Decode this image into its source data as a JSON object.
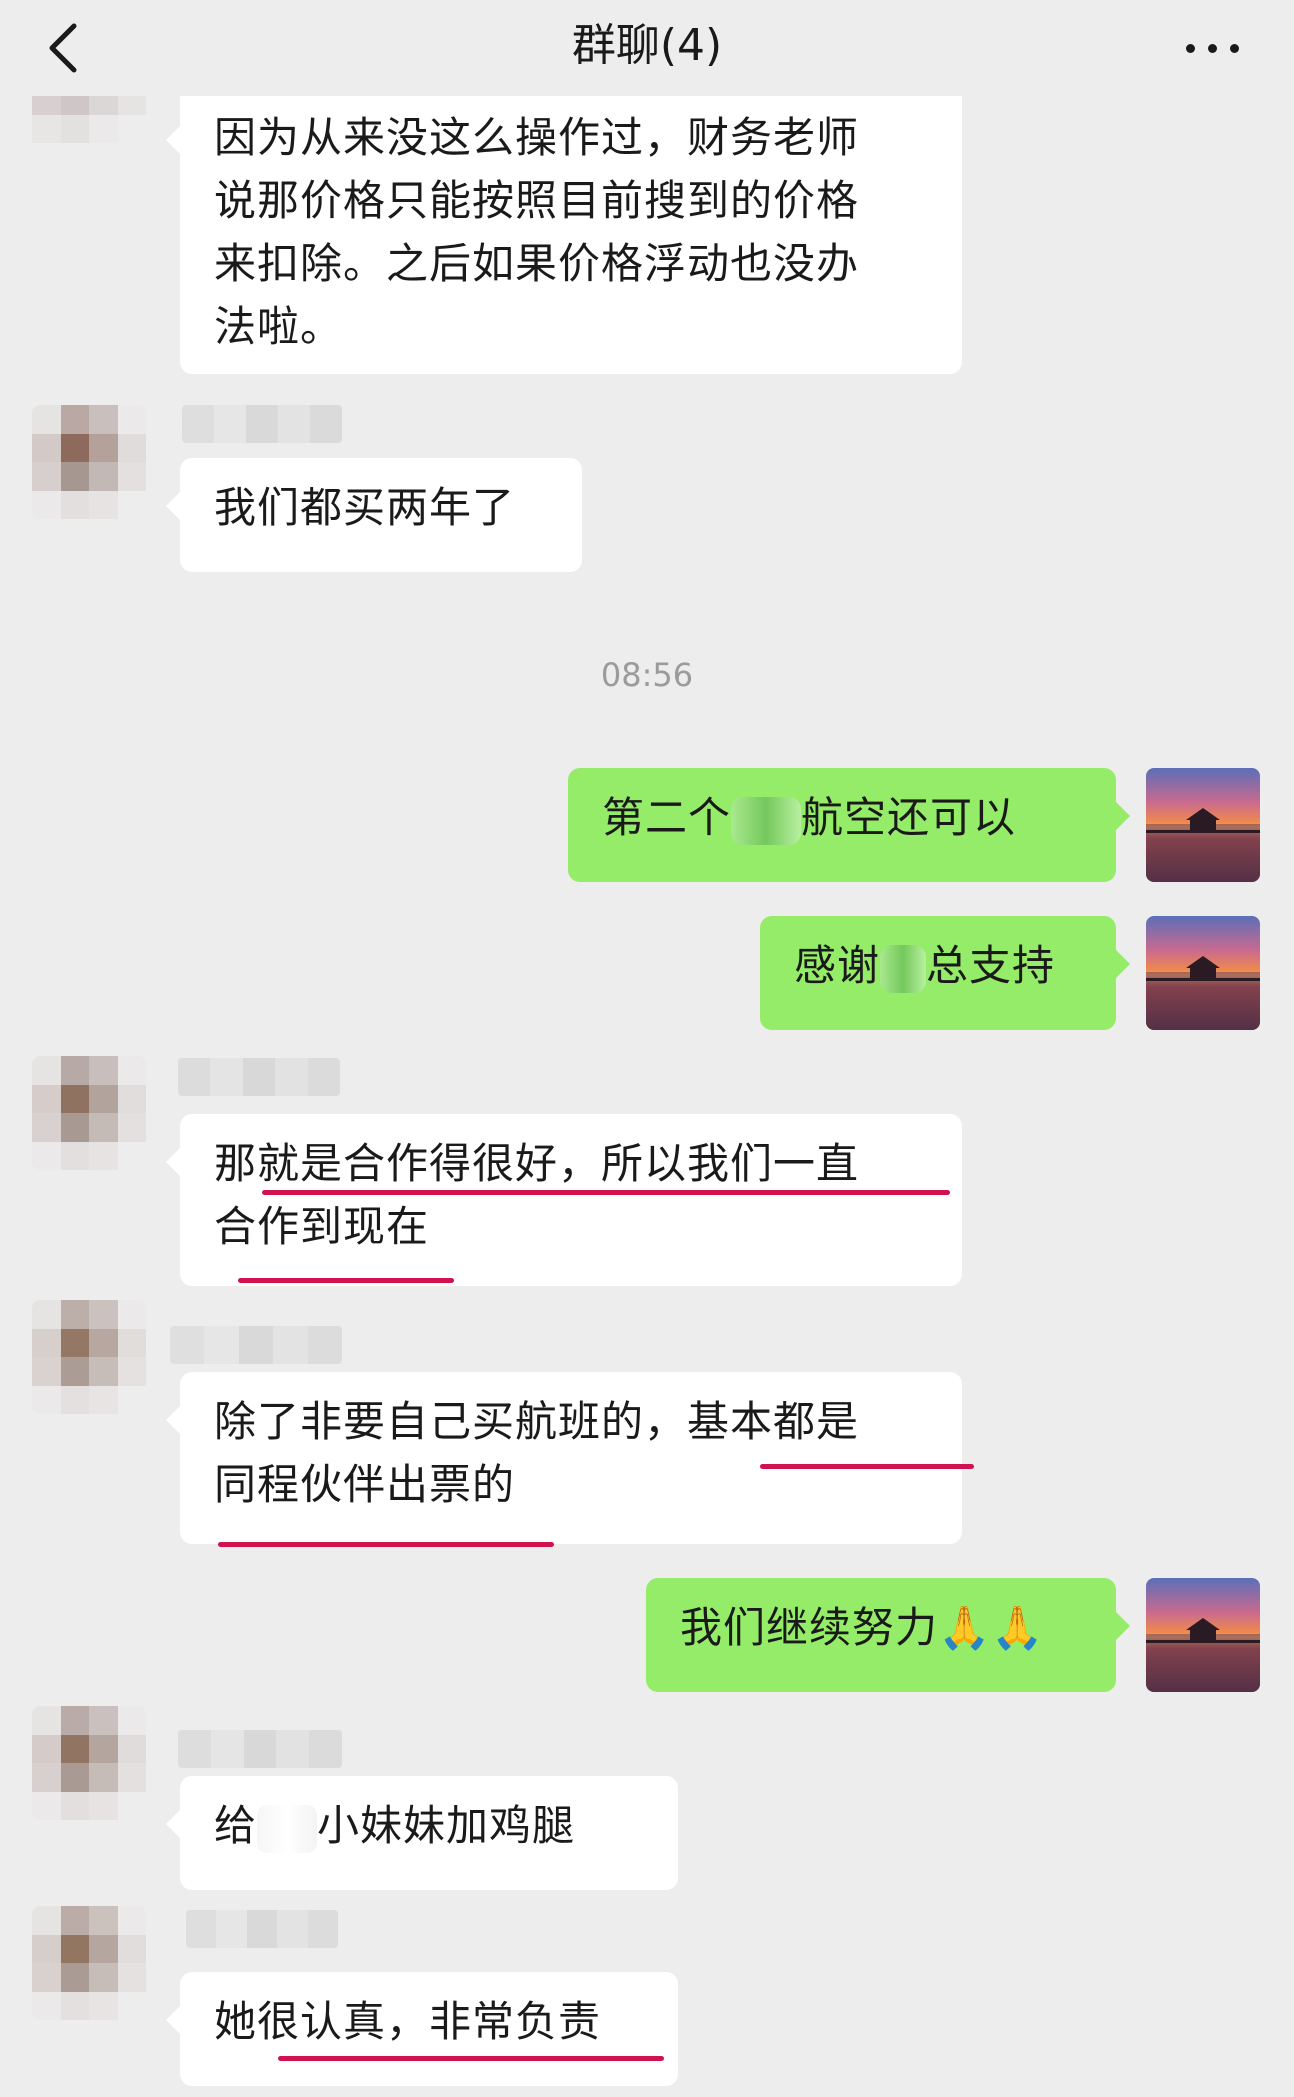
{
  "header": {
    "title": "群聊(4)",
    "back_icon": "chevron-left-icon",
    "more_icon": "more-dots-icon"
  },
  "messages": [
    {
      "side": "left",
      "lines": [
        "因为从来没这么操作过，财务老师",
        "说那价格只能按照目前搜到的价格",
        "来扣除。之后如果价格浮动也没办",
        "法啦。"
      ]
    },
    {
      "side": "left",
      "lines": [
        "我们都买两年了"
      ]
    },
    {
      "side": "right",
      "text_before": "第二个",
      "text_after": "航空还可以"
    },
    {
      "side": "right",
      "text_before": "感谢",
      "text_after": "总支持"
    },
    {
      "side": "left",
      "lines": [
        "那就是合作得很好，所以我们一直",
        "合作到现在"
      ]
    },
    {
      "side": "left",
      "lines": [
        "除了非要自己买航班的，基本都是",
        "同程伙伴出票的"
      ]
    },
    {
      "side": "right",
      "text": "我们继续努力",
      "emoji": "🙏🙏"
    },
    {
      "side": "left",
      "text_before": "给",
      "text_after": "小妹妹加鸡腿"
    },
    {
      "side": "left",
      "lines": [
        "她很认真，非常负责"
      ]
    }
  ],
  "timestamp": "08:56",
  "colors": {
    "background": "#ededed",
    "self_bubble": "#95ec69",
    "other_bubble": "#ffffff",
    "underline": "#d0134f"
  }
}
